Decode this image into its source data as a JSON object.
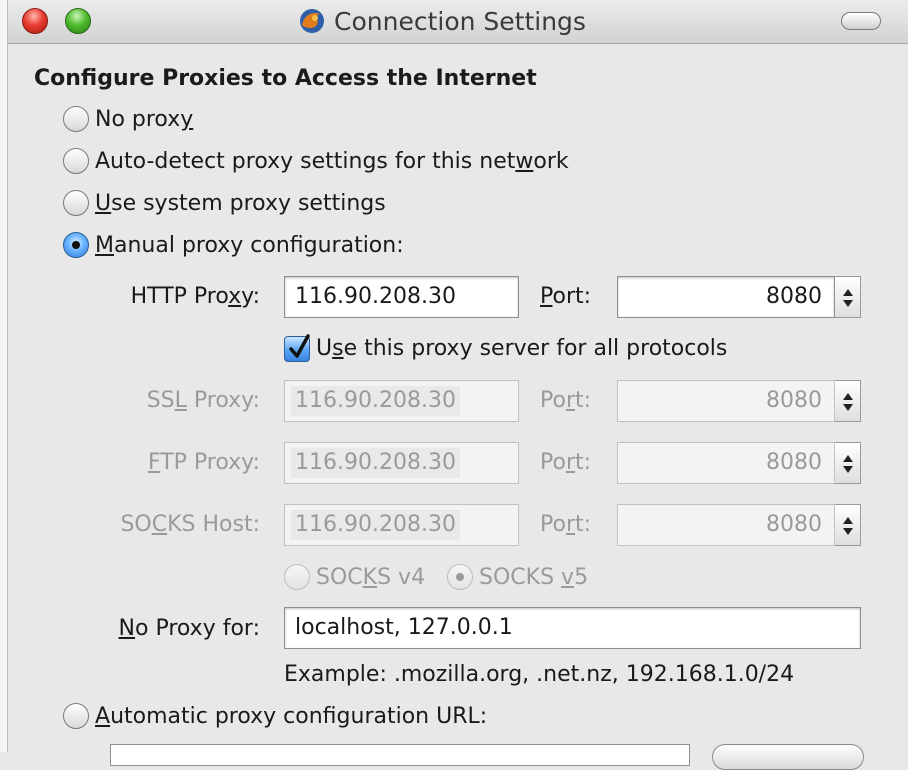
{
  "window": {
    "title": "Connection Settings",
    "app_icon": "firefox-icon"
  },
  "heading": "Configure Proxies to Access the Internet",
  "proxy_modes": {
    "no_proxy": {
      "pre": "No prox",
      "ul": "y",
      "post": ""
    },
    "auto_detect": {
      "pre": "Auto-detect proxy settings for this net",
      "ul": "w",
      "post": "ork"
    },
    "system": {
      "pre": "",
      "ul": "U",
      "post": "se system proxy settings"
    },
    "manual": {
      "pre": "",
      "ul": "M",
      "post": "anual proxy configuration:"
    },
    "auto_url": {
      "pre": "",
      "ul": "A",
      "post": "utomatic proxy configuration URL:"
    },
    "selected": "manual"
  },
  "http": {
    "label_pre": "HTTP Pro",
    "label_ul": "x",
    "label_post": "y:",
    "value": "116.90.208.30",
    "port_label_ul": "P",
    "port_label_post": "ort:",
    "port": "8080"
  },
  "share_all": {
    "checked": true,
    "pre": "U",
    "ul": "s",
    "post": "e this proxy server for all protocols"
  },
  "ssl": {
    "label_pre": "SS",
    "label_ul": "L",
    "label_post": " Proxy:",
    "value": "116.90.208.30",
    "port_label_pre": "Po",
    "port_label_ul": "r",
    "port_label_post": "t:",
    "port": "8080"
  },
  "ftp": {
    "label_pre": "",
    "label_ul": "F",
    "label_post": "TP Proxy:",
    "value": "116.90.208.30",
    "port_label_pre": "Po",
    "port_label_ul": "r",
    "port_label_post": "t:",
    "port": "8080"
  },
  "socks": {
    "label_pre": "SO",
    "label_ul": "C",
    "label_post": "KS Host:",
    "value": "116.90.208.30",
    "port_label_pre": "Po",
    "port_label_ul": "r",
    "port_label_post": "t:",
    "port": "8080"
  },
  "socks_version": {
    "v4": {
      "pre": "SOC",
      "ul": "K",
      "post": "S v4"
    },
    "v5": {
      "pre": "SOCKS ",
      "ul": "v",
      "post": "5"
    },
    "selected": "v5"
  },
  "no_proxy_for": {
    "label_ul": "N",
    "label_post": "o Proxy for:",
    "value": "localhost, 127.0.0.1",
    "example": "Example: .mozilla.org, .net.nz, 192.168.1.0/24"
  }
}
